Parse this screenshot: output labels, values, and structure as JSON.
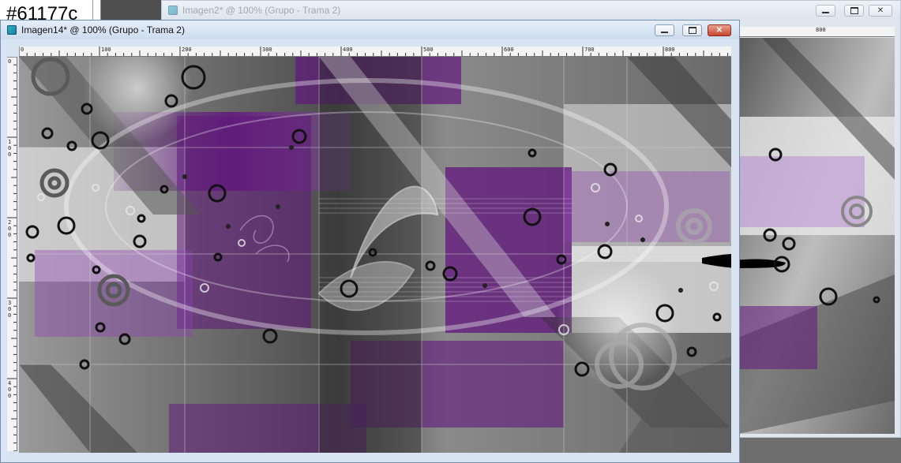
{
  "swatch": {
    "hex_label": "#61177c"
  },
  "back_window": {
    "title": "Imagen2* @ 100% (Grupo - Trama 2)",
    "ruler_label": "800"
  },
  "front_window": {
    "title": "Imagen14* @ 100% (Grupo - Trama 2)",
    "hruler": [
      "0",
      "100",
      "200",
      "300",
      "400",
      "500",
      "600",
      "700",
      "800"
    ],
    "vruler": [
      [
        "0"
      ],
      [
        "1",
        "0",
        "0"
      ],
      [
        "2",
        "0",
        "0"
      ],
      [
        "3",
        "0",
        "0"
      ],
      [
        "4",
        "0",
        "0"
      ]
    ]
  },
  "colors": {
    "purple": "#61177c",
    "purple_light": "#8e3fb3",
    "titlebar_active": "#cddcee",
    "close_red": "#c9472f"
  },
  "icons": {
    "app": "psp-app-icon",
    "minimize": "minimize-icon",
    "maximize": "maximize-icon",
    "close": "close-icon"
  }
}
